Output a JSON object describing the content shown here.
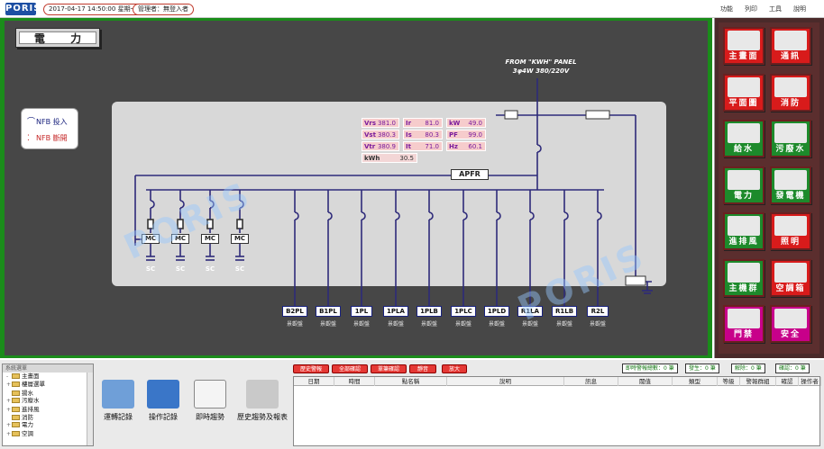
{
  "header": {
    "logo": "PORIS",
    "datetime": "2017-04-17 14:50:00 星期一",
    "user": "管理者：無登入者",
    "menu": [
      "功能",
      "列印",
      "工具",
      "說明"
    ]
  },
  "screen": {
    "title": "電 力",
    "legend": {
      "on_label": "NFB 投入",
      "off_label": "NFB 斷開",
      "on_color": "#1a237e",
      "off_color": "#c62828"
    },
    "source_panel": [
      "FROM \"KWH\" PANEL",
      "3φ4W 380/220V"
    ],
    "readings": [
      {
        "key": "Vrs",
        "value": "381.0"
      },
      {
        "key": "Ir",
        "value": "81.0"
      },
      {
        "key": "kW",
        "value": "49.0"
      },
      {
        "key": "Vst",
        "value": "380.3"
      },
      {
        "key": "Is",
        "value": "80.3"
      },
      {
        "key": "PF",
        "value": "99.0"
      },
      {
        "key": "Vtr",
        "value": "380.9"
      },
      {
        "key": "It",
        "value": "71.0"
      },
      {
        "key": "Hz",
        "value": "60.1"
      },
      {
        "key": "kWh",
        "value": "30.5"
      }
    ],
    "apfr_label": "APFR",
    "capacitor_banks": [
      {
        "mc": "MC",
        "sc": "SC"
      },
      {
        "mc": "MC",
        "sc": "SC"
      },
      {
        "mc": "MC",
        "sc": "SC"
      },
      {
        "mc": "MC",
        "sc": "SC"
      }
    ],
    "feeders": [
      {
        "name": "B2PL",
        "sub": "景觀盤"
      },
      {
        "name": "B1PL",
        "sub": "景觀盤"
      },
      {
        "name": "1PL",
        "sub": "景觀盤"
      },
      {
        "name": "1PLA",
        "sub": "景觀盤"
      },
      {
        "name": "1PLB",
        "sub": "景觀盤"
      },
      {
        "name": "1PLC",
        "sub": "景觀盤"
      },
      {
        "name": "1PLD",
        "sub": "景觀盤"
      },
      {
        "name": "R1LA",
        "sub": "景觀盤"
      },
      {
        "name": "R1LB",
        "sub": "景觀盤"
      },
      {
        "name": "R2L",
        "sub": "景觀盤"
      }
    ],
    "watermark": "PORIS"
  },
  "nav": [
    {
      "label": "主畫面",
      "style": "red",
      "icon": "main-screen-icon"
    },
    {
      "label": "通訊",
      "style": "red",
      "icon": "communication-icon"
    },
    {
      "label": "平面圖",
      "style": "red",
      "icon": "floor-plan-icon"
    },
    {
      "label": "消防",
      "style": "red",
      "icon": "fire-icon"
    },
    {
      "label": "給水",
      "style": "green",
      "icon": "water-supply-icon"
    },
    {
      "label": "污廢水",
      "style": "green",
      "icon": "wastewater-icon"
    },
    {
      "label": "電力",
      "style": "green",
      "icon": "power-icon"
    },
    {
      "label": "發電機",
      "style": "green",
      "icon": "generator-icon"
    },
    {
      "label": "進排風",
      "style": "green",
      "icon": "ventilation-icon"
    },
    {
      "label": "照明",
      "style": "red",
      "icon": "lighting-icon"
    },
    {
      "label": "主機群",
      "style": "green",
      "icon": "host-group-icon"
    },
    {
      "label": "空調箱",
      "style": "red",
      "icon": "ahu-icon"
    },
    {
      "label": "門禁",
      "style": "magenta",
      "icon": "access-control-icon"
    },
    {
      "label": "安全",
      "style": "magenta",
      "icon": "security-icon"
    }
  ],
  "tree": {
    "title": "系統選單",
    "items": [
      {
        "label": "主畫面",
        "pm": "-"
      },
      {
        "label": "樓層選單",
        "pm": "+"
      },
      {
        "label": "揚水",
        "pm": ""
      },
      {
        "label": "污廢水",
        "pm": "+"
      },
      {
        "label": "進排風",
        "pm": "+"
      },
      {
        "label": "消防",
        "pm": ""
      },
      {
        "label": "電力",
        "pm": "+"
      },
      {
        "label": "空調",
        "pm": "+"
      }
    ]
  },
  "tools": [
    {
      "label": "運轉記錄",
      "icon": "calendar-icon"
    },
    {
      "label": "操作記錄",
      "icon": "notebook-icon"
    },
    {
      "label": "即時趨勢",
      "icon": "trend-icon"
    },
    {
      "label": "歷史趨勢及報表",
      "icon": "report-icon"
    }
  ],
  "alarm": {
    "buttons": [
      "歷史警報",
      "全部確認",
      "單筆確認",
      "靜音",
      "放大"
    ],
    "realtime_label": "即時警報總數：0 筆",
    "occur_label": "發生：0 筆",
    "clear_label": "解除：0 筆",
    "confirm_label": "確認：0 筆",
    "columns": [
      "日期",
      "時間",
      "點名稱",
      "說明",
      "訊息",
      "閥值",
      "類型",
      "等級",
      "警報群組",
      "確認",
      "操作者"
    ]
  }
}
